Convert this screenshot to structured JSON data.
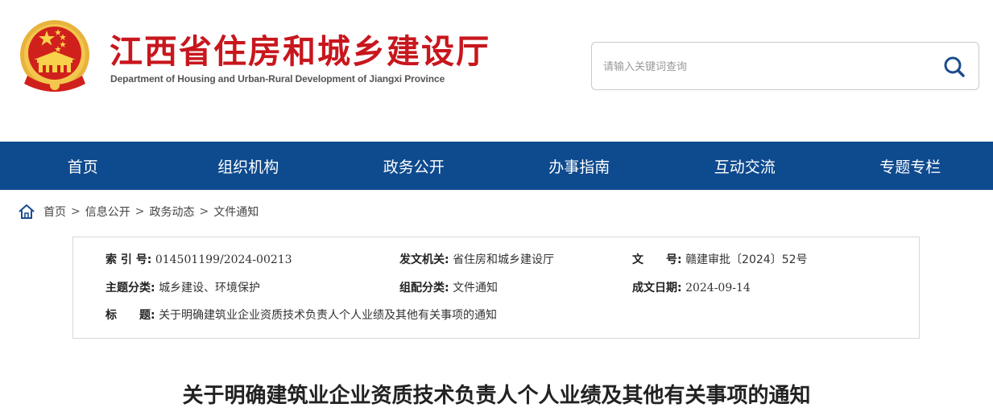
{
  "header": {
    "title": "江西省住房和城乡建设厅",
    "subtitle": "Department of Housing and Urban-Rural Development of Jiangxi Province",
    "emblem_icon": "national-emblem-icon"
  },
  "search": {
    "placeholder": "请输入关键词查询",
    "icon": "search-icon"
  },
  "nav": {
    "items": [
      "首页",
      "组织机构",
      "政务公开",
      "办事指南",
      "互动交流",
      "专题专栏"
    ]
  },
  "breadcrumb": {
    "icon": "home-icon",
    "items": [
      "首页",
      "信息公开",
      "政务动态",
      "文件通知"
    ],
    "separator": ">"
  },
  "meta": {
    "index_label": "索 引 号:",
    "index_value": "014501199/2024-00213",
    "issuer_label": "发文机关:",
    "issuer_value": "省住房和城乡建设厅",
    "doc_no_label": "文　　号:",
    "doc_no_value": "赣建审批〔2024〕52号",
    "topic_label": "主题分类:",
    "topic_value": "城乡建设、环境保护",
    "org_label": "组配分类:",
    "org_value": "文件通知",
    "date_label": "成文日期:",
    "date_value": "2024-09-14",
    "title_label": "标　　题:",
    "title_value": "关于明确建筑业企业资质技术负责人个人业绩及其他有关事项的通知"
  },
  "article": {
    "title": "关于明确建筑业企业资质技术负责人个人业绩及其他有关事项的通知"
  },
  "colors": {
    "brand_red": "#c8161d",
    "nav_blue": "#0e4a8e",
    "search_icon_blue": "#1a4c8f"
  }
}
